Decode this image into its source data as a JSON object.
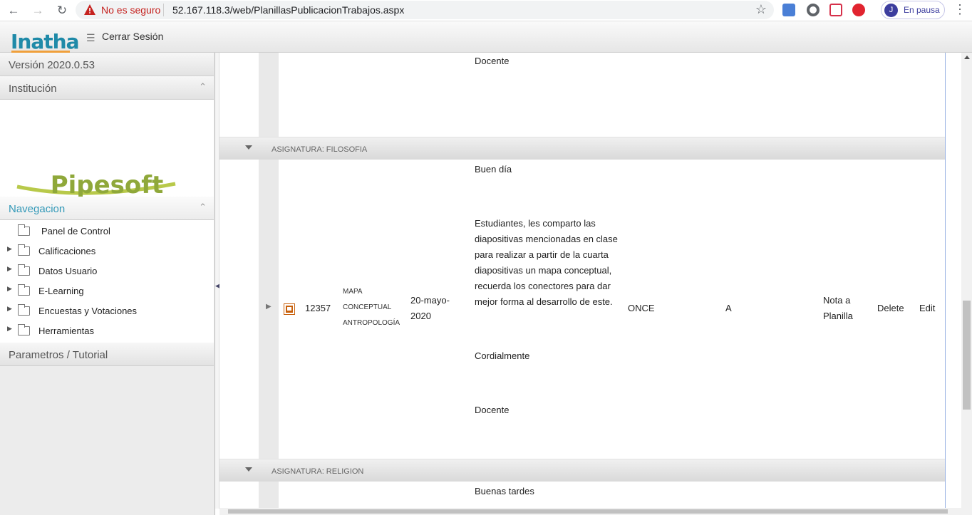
{
  "browser": {
    "not_secure": "No es seguro",
    "url": "52.167.118.3/web/PlanillasPublicacionTrabajos.aspx",
    "profile_initial": "J",
    "profile_label": "En pausa"
  },
  "app": {
    "logo": "Inatha",
    "logout": "Cerrar Sesión"
  },
  "sidebar": {
    "version": "Versión 2020.0.53",
    "institucion": "Institución",
    "institution_logo": "Pipesoft",
    "nav_header": "Navegacion",
    "items": [
      {
        "label": "Panel de Control"
      },
      {
        "label": "Calificaciones"
      },
      {
        "label": "Datos Usuario"
      },
      {
        "label": "E-Learning"
      },
      {
        "label": "Encuestas y Votaciones"
      },
      {
        "label": "Herramientas"
      }
    ],
    "params": "Parametros / Tutorial"
  },
  "content": {
    "top_tail": "Docente",
    "group1": "ASIGNATURA: FILOSOFIA",
    "row": {
      "id": "12357",
      "title_lines": [
        "MAPA",
        "CONCEPTUAL",
        "ANTROPOLOGÍA"
      ],
      "date_lines": [
        "20-mayo-",
        "2020"
      ],
      "desc_greet": "Buen día",
      "desc_lines": [
        "Estudiantes, les comparto las",
        "diapositivas mencionadas en clase",
        "para realizar a partir de la cuarta",
        "diapositivas un mapa conceptual,",
        "recuerda los conectores para dar",
        "mejor forma al desarrollo de este."
      ],
      "desc_close": "Cordialmente",
      "desc_sign": "Docente",
      "grade": "ONCE",
      "group": "A",
      "nota_lines": [
        "Nota a",
        "Planilla"
      ],
      "delete": "Delete",
      "edit": "Edit"
    },
    "group2": "ASIGNATURA: RELIGION",
    "bottom_head": "Buenas tardes"
  },
  "colors": {
    "accent": "#3399b8",
    "brand": "#1f8aa8",
    "warning": "#c5221f",
    "file_icon": "#c8600b"
  }
}
